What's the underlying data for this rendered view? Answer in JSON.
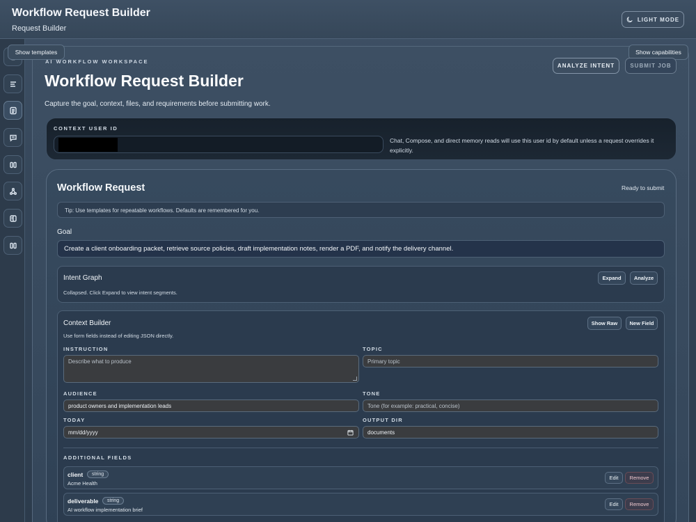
{
  "header": {
    "title": "Workflow Request Builder",
    "subtitle": "Request Builder",
    "light_mode_label": "LIGHT MODE"
  },
  "rail": {
    "icons": [
      "home-icon",
      "list-icon",
      "document-icon",
      "chat-icon",
      "columns-icon",
      "graph-icon",
      "book-icon",
      "columns-icon"
    ]
  },
  "toggles": {
    "show_templates": "Show templates",
    "show_capabilities": "Show capabilities"
  },
  "workspace": {
    "eyebrow": "AI WORKFLOW WORKSPACE",
    "title": "Workflow Request Builder",
    "description": "Capture the goal, context, files, and requirements before submitting work.",
    "analyze_intent": "ANALYZE INTENT",
    "submit_job": "SUBMIT JOB"
  },
  "context_user": {
    "label": "CONTEXT USER ID",
    "help": "Chat, Compose, and direct memory reads will use this user id by default unless a request overrides it explicitly."
  },
  "workflow_request": {
    "title": "Workflow Request",
    "status": "Ready to submit",
    "tip": "Tip: Use templates for repeatable workflows. Defaults are remembered for you.",
    "goal_label": "Goal",
    "goal_value": "Create a client onboarding packet, retrieve source policies, draft implementation notes, render a PDF, and notify the delivery channel."
  },
  "intent_graph": {
    "title": "Intent Graph",
    "note": "Collapsed. Click Expand to view intent segments.",
    "expand": "Expand",
    "analyze": "Analyze"
  },
  "context_builder": {
    "title": "Context Builder",
    "note": "Use form fields instead of editing JSON directly.",
    "show_raw": "Show Raw",
    "new_field": "New Field",
    "fields": {
      "instruction": {
        "label": "INSTRUCTION",
        "value": "",
        "placeholder": "Describe what to produce"
      },
      "topic": {
        "label": "TOPIC",
        "value": "",
        "placeholder": "Primary topic"
      },
      "audience": {
        "label": "AUDIENCE",
        "value": "product owners and implementation leads",
        "placeholder": ""
      },
      "tone": {
        "label": "TONE",
        "value": "",
        "placeholder": "Tone (for example: practical, concise)"
      },
      "today": {
        "label": "TODAY",
        "value": "",
        "placeholder": "mm/dd/yyyy"
      },
      "output_dir": {
        "label": "OUTPUT DIR",
        "value": "documents",
        "placeholder": ""
      }
    },
    "additional_label": "ADDITIONAL FIELDS",
    "additional": [
      {
        "name": "client",
        "type": "string",
        "value": "Acme Health",
        "edit": "Edit",
        "remove": "Remove"
      },
      {
        "name": "deliverable",
        "type": "string",
        "value": "AI workflow implementation brief",
        "edit": "Edit",
        "remove": "Remove"
      }
    ]
  }
}
